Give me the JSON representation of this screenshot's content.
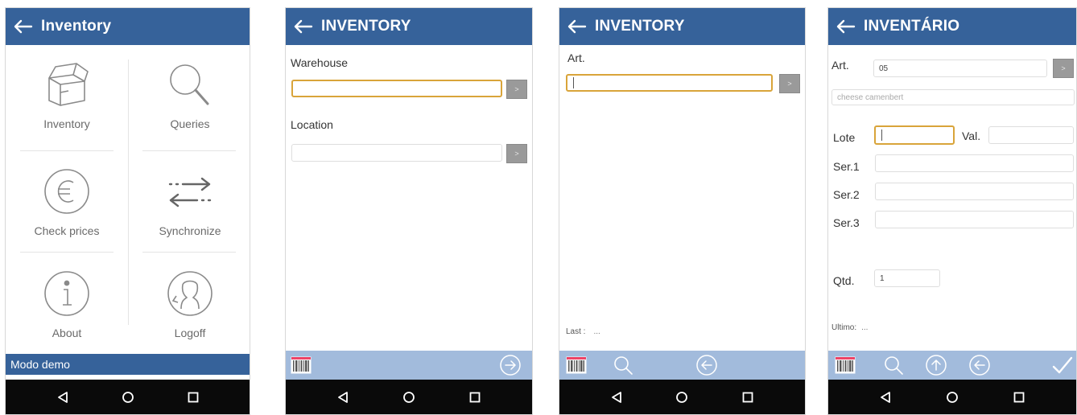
{
  "screen1": {
    "title": "Inventory",
    "menu": [
      {
        "label": "Inventory",
        "icon": "box-icon"
      },
      {
        "label": "Queries",
        "icon": "magnifier-icon"
      },
      {
        "label": "Check prices",
        "icon": "euro-icon"
      },
      {
        "label": "Synchronize",
        "icon": "sync-arrows-icon"
      },
      {
        "label": "About",
        "icon": "info-icon"
      },
      {
        "label": "Logoff",
        "icon": "user-logoff-icon"
      }
    ],
    "status": "Modo demo"
  },
  "screen2": {
    "title": "INVENTORY",
    "warehouse_label": "Warehouse",
    "warehouse_value": "",
    "location_label": "Location",
    "location_value": "",
    "go_label": ">"
  },
  "screen3": {
    "title": "INVENTORY",
    "art_label": "Art.",
    "art_value": "",
    "go_label": ">",
    "last_label": "Last :",
    "last_value": "..."
  },
  "screen4": {
    "title": "INVENTÁRIO",
    "art_label": "Art.",
    "art_value": "05",
    "go_label": ">",
    "description": "cheese camenbert",
    "lote_label": "Lote",
    "val_label": "Val.",
    "ser1_label": "Ser.1",
    "ser2_label": "Ser.2",
    "ser3_label": "Ser.3",
    "qtd_label": "Qtd.",
    "qtd_value": "1",
    "ultimo_label": "Ultimo:",
    "ultimo_value": "..."
  },
  "colors": {
    "appbar": "#36629a",
    "toolbar": "#a2bbdc",
    "focus": "#d9a43a",
    "navbar": "#0a0a0a"
  }
}
